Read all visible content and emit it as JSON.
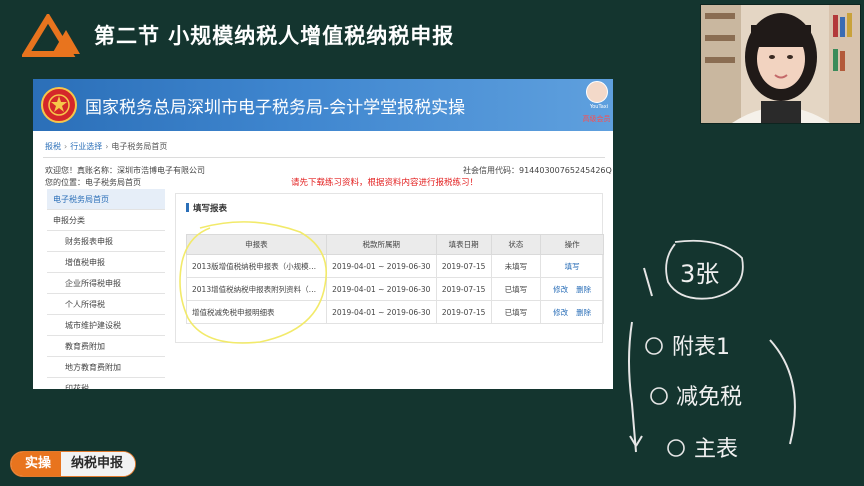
{
  "slide": {
    "title": "第二节 小规模纳税人增值税纳税申报",
    "tag_left": "实操",
    "tag_right": "纳税申报",
    "colors": {
      "background": "#14352f",
      "accent": "#e8741e",
      "highlight": "#f2ea6a"
    }
  },
  "site": {
    "title": "国家税务总局深圳市电子税务局-会计学堂报税实操",
    "user_name": "YouTaxi",
    "user_level": "高级会员"
  },
  "breadcrumb": {
    "items": [
      "报税",
      "行业选择",
      "电子税务局首页"
    ],
    "separator": "›"
  },
  "info": {
    "welcome": "欢迎您！真账名称：深圳市浩博电子有限公司",
    "location": "您的位置：电子税务局首页",
    "credit_code": "社会信用代码：91440300765245426Q",
    "notice": "请先下载练习资料，根据资料内容进行报税练习！"
  },
  "sidebar": {
    "home": "电子税务局首页",
    "category": "申报分类",
    "items": [
      "财务报表申报",
      "增值税申报",
      "企业所得税申报",
      "个人所得税",
      "城市维护建设税",
      "教育费附加",
      "地方教育费附加",
      "印花税"
    ]
  },
  "report": {
    "title": "填写报表",
    "headers": [
      "申报表",
      "税款所属期",
      "填表日期",
      "状态",
      "操作"
    ],
    "rows": [
      {
        "name": "2013版增值税纳税申报表（小规模…",
        "period": "2019-04-01 ~ 2019-06-30",
        "date": "2019-07-15",
        "status": "未填写",
        "actions": [
          "填写"
        ]
      },
      {
        "name": "2013增值税纳税申报表附列资料（…",
        "period": "2019-04-01 ~ 2019-06-30",
        "date": "2019-07-15",
        "status": "已填写",
        "actions": [
          "修改",
          "删除"
        ]
      },
      {
        "name": "增值税减免税申报明细表",
        "period": "2019-04-01 ~ 2019-06-30",
        "date": "2019-07-15",
        "status": "已填写",
        "actions": [
          "修改",
          "删除"
        ]
      }
    ]
  },
  "annotations": {
    "top": "3张",
    "items": [
      "附表1",
      "减免税",
      "主表"
    ]
  }
}
